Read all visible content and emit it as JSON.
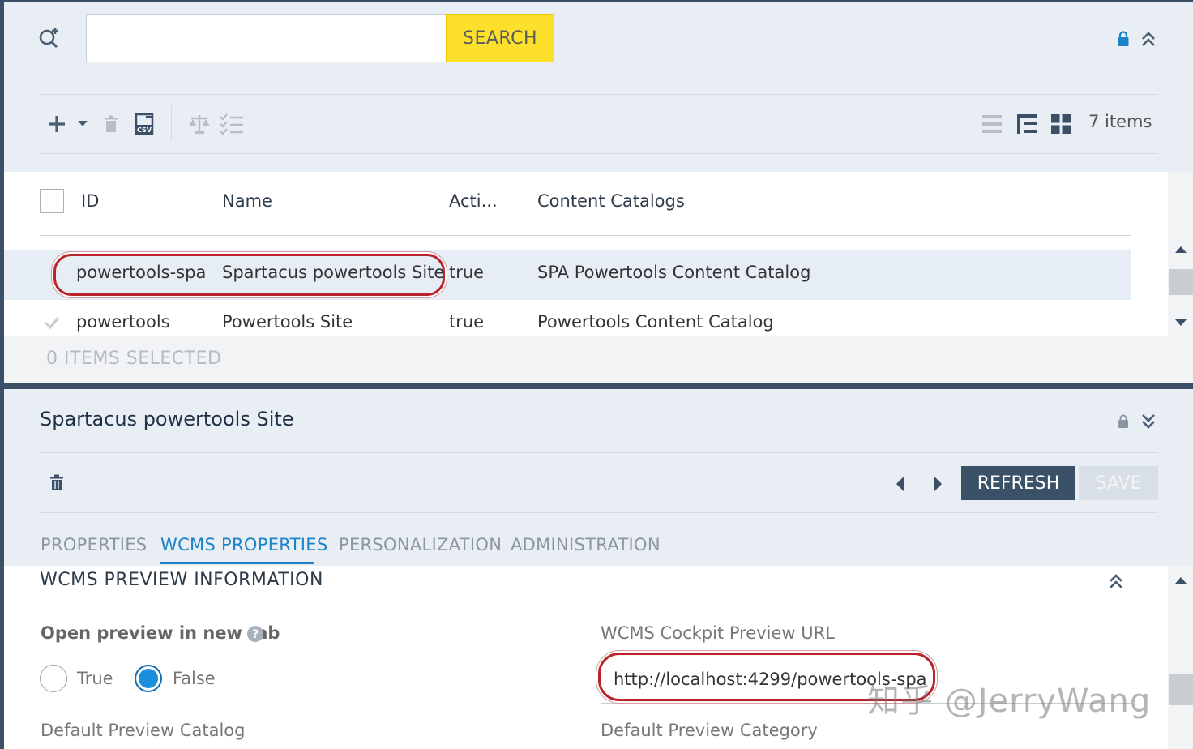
{
  "search": {
    "button_label": "SEARCH",
    "placeholder": ""
  },
  "toolbar": {
    "items_count": "7 items"
  },
  "table": {
    "headers": [
      "ID",
      "Name",
      "Acti...",
      "Content Catalogs"
    ],
    "rows": [
      {
        "id": "powertools-spa",
        "name": "Spartacus powertools Site",
        "active": "true",
        "catalogs": "SPA Powertools Content Catalog"
      },
      {
        "id": "powertools",
        "name": "Powertools Site",
        "active": "true",
        "catalogs": "Powertools Content Catalog"
      }
    ],
    "selection_status": "0 ITEMS SELECTED"
  },
  "detail": {
    "title": "Spartacus powertools Site",
    "refresh_label": "REFRESH",
    "save_label": "SAVE",
    "tabs": [
      "PROPERTIES",
      "WCMS PROPERTIES",
      "PERSONALIZATION",
      "ADMINISTRATION"
    ],
    "active_tab": "WCMS PROPERTIES",
    "section_title": "WCMS PREVIEW INFORMATION",
    "open_preview_label": "Open preview in new tab",
    "radio_true": "True",
    "radio_false": "False",
    "radio_selected": "False",
    "preview_url_label": "WCMS Cockpit Preview URL",
    "preview_url_value": "http://localhost:4299/powertools-spa",
    "default_catalog_label": "Default Preview Catalog",
    "default_category_label": "Default Preview Category"
  },
  "watermark": "知乎 @JerryWang",
  "colors": {
    "search_button": "#fde02c",
    "refresh_button": "#3b5168",
    "active_tab": "#1b84c8",
    "highlight": "#b9242b"
  }
}
